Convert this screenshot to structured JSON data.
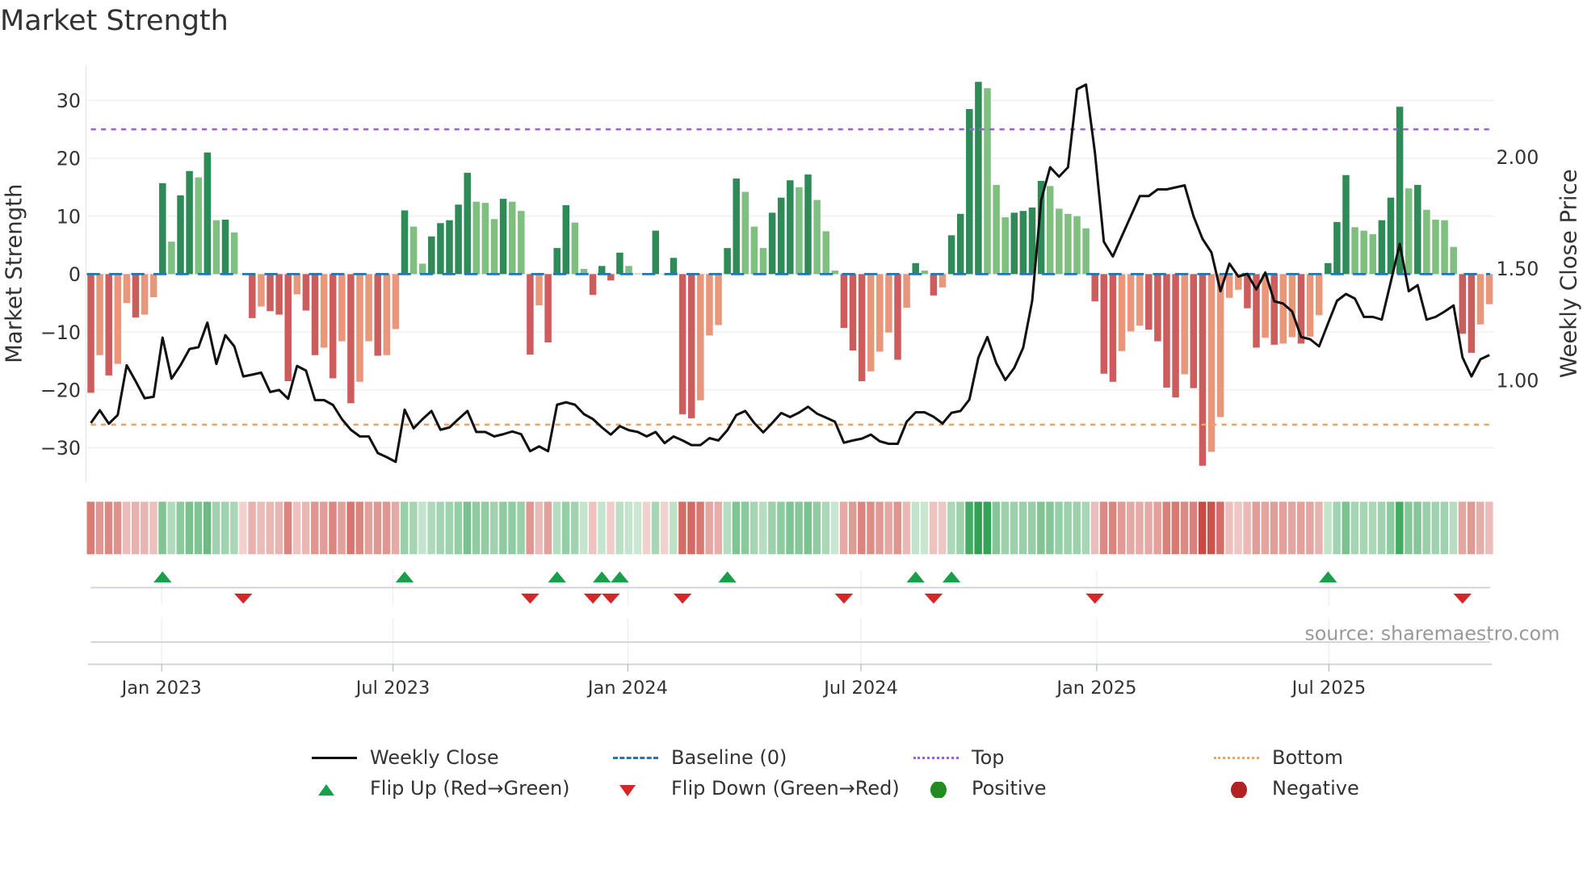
{
  "title": "Market Strength",
  "source": "source: sharemaestro.com",
  "legend": {
    "weekly_close": "Weekly Close",
    "baseline": "Baseline (0)",
    "top": "Top",
    "bottom": "Bottom",
    "flip_up": "Flip Up (Red→Green)",
    "flip_down": "Flip Down (Green→Red)",
    "positive": "Positive",
    "negative": "Negative"
  },
  "colors": {
    "green_dark": "#2e8b57",
    "green_light": "#7fbf7f",
    "red_dark": "#cd5c5c",
    "red_light": "#e9967a",
    "line": "#111111",
    "baseline": "#1f77b4",
    "top": "#9b5de5",
    "bottom": "#f4a261",
    "flip_up": "#1a9e4a",
    "flip_down": "#d62728",
    "positive": "#228b22",
    "negative": "#b22222"
  },
  "chart_data": {
    "type": "bar+line",
    "title": "Market Strength",
    "ylabel": "Market Strength",
    "ylabel_right": "Weekly Close Price",
    "ylim": [
      -36,
      36
    ],
    "ylim_right": [
      0.54,
      2.41
    ],
    "y_ticks": [
      30,
      20,
      10,
      0,
      -10,
      -20,
      -30
    ],
    "y_tick_labels": [
      "30",
      "20",
      "10",
      "0",
      "−10",
      "−20",
      "−30"
    ],
    "y_right_ticks": [
      2.0,
      1.5,
      1.0
    ],
    "y_right_tick_labels": [
      "2.00",
      "1.50",
      "1.00"
    ],
    "top_level": 25,
    "bottom_level": -26,
    "x_ticks": [
      {
        "label": "Jan 2023",
        "week": 7.9
      },
      {
        "label": "Jul 2023",
        "week": 33.7
      },
      {
        "label": "Jan 2024",
        "week": 59.9
      },
      {
        "label": "Jul 2024",
        "week": 85.9
      },
      {
        "label": "Jan 2025",
        "week": 112.2
      },
      {
        "label": "Jul 2025",
        "week": 138.1
      }
    ],
    "strength": [
      -20.5,
      -14,
      -17.5,
      -15.5,
      -5,
      -7.5,
      -7,
      -4,
      15.7,
      5.6,
      13.6,
      17.8,
      16.7,
      21,
      9.3,
      9.4,
      7.2,
      0,
      -7.6,
      -5.6,
      -6.4,
      -7,
      -18.5,
      -3.5,
      -6.3,
      -14,
      -12.7,
      -18,
      -11.6,
      -22.3,
      -18.6,
      -11.6,
      -14.1,
      -14,
      -9.5,
      11,
      8.2,
      1.8,
      6.5,
      8.8,
      9.3,
      12,
      17.5,
      12.5,
      12.3,
      9.5,
      13,
      12.5,
      10.9,
      -13.9,
      -5.4,
      -11.8,
      4.5,
      11.9,
      8.9,
      0.9,
      -3.6,
      1.4,
      -1.1,
      3.7,
      1.4,
      0.1,
      0,
      7.5,
      0,
      2.8,
      -24.2,
      -24.9,
      -21.8,
      -10.6,
      -8.8,
      4.5,
      16.5,
      14.2,
      8.2,
      4.5,
      10.6,
      13.2,
      16.2,
      15,
      17.2,
      12.8,
      7.4,
      0.6,
      -9.3,
      -13.2,
      -18.5,
      -16.8,
      -13.4,
      -10.1,
      -14.8,
      -5.8,
      1.9,
      0.6,
      -3.7,
      -2.3,
      6.7,
      10.4,
      28.5,
      33.2,
      32.1,
      15.4,
      9.8,
      10.6,
      10.9,
      11.5,
      16.1,
      15.2,
      11.3,
      10.4,
      10,
      7.9,
      -4.7,
      -17.2,
      -18.6,
      -13.3,
      -9.9,
      -8.9,
      -9.6,
      -11.6,
      -19.6,
      -21.3,
      -17.3,
      -19.7,
      -33.1,
      -30.7,
      -24.7,
      -4.1,
      -2.7,
      -5.9,
      -12.7,
      -11,
      -12.2,
      -12,
      -10.9,
      -12,
      -10.8,
      -7.1,
      1.9,
      9,
      17.1,
      8.1,
      7.5,
      6.9,
      9.3,
      13.2,
      28.9,
      14.8,
      15.4,
      11.1,
      9.4,
      9.3,
      4.7,
      -10.3,
      -13.6,
      -8.7,
      -5.2
    ],
    "weekly_close": [
      0.807,
      0.864,
      0.804,
      0.843,
      1.066,
      0.994,
      0.918,
      0.925,
      1.19,
      1.006,
      1.066,
      1.139,
      1.147,
      1.257,
      1.072,
      1.201,
      1.151,
      1.016,
      1.024,
      1.033,
      0.946,
      0.955,
      0.916,
      1.063,
      1.042,
      0.91,
      0.91,
      0.888,
      0.825,
      0.777,
      0.747,
      0.747,
      0.672,
      0.654,
      0.633,
      0.867,
      0.783,
      0.825,
      0.861,
      0.777,
      0.787,
      0.825,
      0.861,
      0.767,
      0.767,
      0.747,
      0.757,
      0.769,
      0.757,
      0.681,
      0.702,
      0.681,
      0.889,
      0.9,
      0.889,
      0.847,
      0.825,
      0.787,
      0.755,
      0.793,
      0.775,
      0.767,
      0.747,
      0.767,
      0.717,
      0.747,
      0.729,
      0.708,
      0.708,
      0.739,
      0.729,
      0.775,
      0.843,
      0.861,
      0.807,
      0.765,
      0.807,
      0.852,
      0.834,
      0.854,
      0.88,
      0.849,
      0.831,
      0.813,
      0.719,
      0.729,
      0.737,
      0.755,
      0.725,
      0.714,
      0.714,
      0.813,
      0.855,
      0.855,
      0.835,
      0.805,
      0.853,
      0.861,
      0.912,
      1.1,
      1.193,
      1.075,
      1.0,
      1.054,
      1.145,
      1.355,
      1.807,
      1.954,
      1.912,
      1.954,
      2.304,
      2.325,
      2.018,
      1.62,
      1.554,
      1.645,
      1.735,
      1.825,
      1.825,
      1.855,
      1.855,
      1.864,
      1.873,
      1.735,
      1.633,
      1.572,
      1.398,
      1.522,
      1.464,
      1.476,
      1.406,
      1.482,
      1.353,
      1.343,
      1.307,
      1.193,
      1.183,
      1.151,
      1.253,
      1.355,
      1.386,
      1.365,
      1.283,
      1.283,
      1.271,
      1.44,
      1.611,
      1.398,
      1.425,
      1.271,
      1.283,
      1.307,
      1.334,
      1.102,
      1.016,
      1.093,
      1.112
    ],
    "flip_up_weeks": [
      8,
      35,
      52,
      57,
      59,
      71,
      92,
      96,
      138
    ],
    "flip_down_weeks": [
      17,
      49,
      56,
      58,
      66,
      84,
      94,
      112,
      153
    ]
  }
}
